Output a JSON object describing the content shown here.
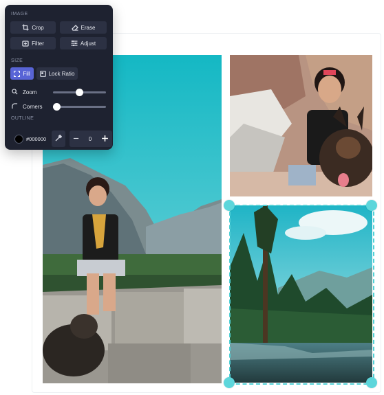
{
  "panel": {
    "image_section": {
      "label": "IMAGE",
      "buttons": [
        {
          "label": "Crop",
          "icon": "crop-icon"
        },
        {
          "label": "Erase",
          "icon": "eraser-icon"
        },
        {
          "label": "Filter",
          "icon": "filter-icon"
        },
        {
          "label": "Adjust",
          "icon": "sliders-icon"
        }
      ]
    },
    "size_section": {
      "label": "SIZE",
      "fill_label": "Fill",
      "lock_ratio_label": "Lock Ratio",
      "zoom_label": "Zoom",
      "zoom_level": 0.5,
      "corners_label": "Corners",
      "corners_level": 0.0
    },
    "outline_section": {
      "label": "OUTLINE",
      "color_value": "#000000",
      "width_value": "0"
    }
  },
  "canvas": {
    "photos": [
      {
        "subject": "woman sitting on stone wall with dog in Yosemite valley"
      },
      {
        "subject": "woman with dog by waterfall rocks"
      },
      {
        "subject": "river through pine forest under blue sky"
      }
    ],
    "selected_photo": 3
  },
  "colors": {
    "panel_bg": "#1e2230",
    "button_bg": "#2c3143",
    "accent": "#5864d6",
    "selection": "#5dd6db"
  }
}
